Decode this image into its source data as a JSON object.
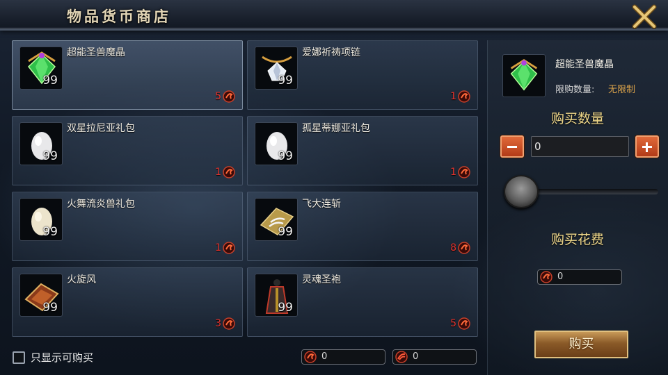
{
  "header": {
    "title": "物品货币商店",
    "close_icon": "close-x-icon"
  },
  "items": [
    {
      "name": "超能圣兽魔晶",
      "qty": "99",
      "price": "5",
      "icon": "green-gem-icon",
      "selected": true
    },
    {
      "name": "爱娜祈祷项链",
      "qty": "99",
      "price": "1",
      "icon": "diamond-necklace-icon"
    },
    {
      "name": "双星拉尼亚礼包",
      "qty": "99",
      "price": "1",
      "icon": "white-egg-icon"
    },
    {
      "name": "孤星蒂娜亚礼包",
      "qty": "99",
      "price": "1",
      "icon": "white-egg-icon"
    },
    {
      "name": "火舞流炎兽礼包",
      "qty": "99",
      "price": "1",
      "icon": "cream-egg-icon"
    },
    {
      "name": "飞大连斩",
      "qty": "99",
      "price": "8",
      "icon": "claw-book-icon"
    },
    {
      "name": "火旋风",
      "qty": "99",
      "price": "3",
      "icon": "fire-book-icon"
    },
    {
      "name": "灵魂圣袍",
      "qty": "99",
      "price": "5",
      "icon": "robe-icon"
    }
  ],
  "detail": {
    "name": "超能圣兽魔晶",
    "limit_label": "限购数量:",
    "limit_value": "无限制",
    "buy_qty_title": "购买数量",
    "qty_value": "0",
    "slider_fraction": 0,
    "cost_title": "购买花费",
    "cost_value": "0",
    "buy_label": "购买"
  },
  "footer": {
    "filter_label": "只显示可购买",
    "filter_checked": false,
    "balance_1": "0",
    "balance_2": "0"
  },
  "colors": {
    "price_red": "#e4322c",
    "gold_text": "#f0d88a",
    "limit_orange": "#d9a24a"
  }
}
